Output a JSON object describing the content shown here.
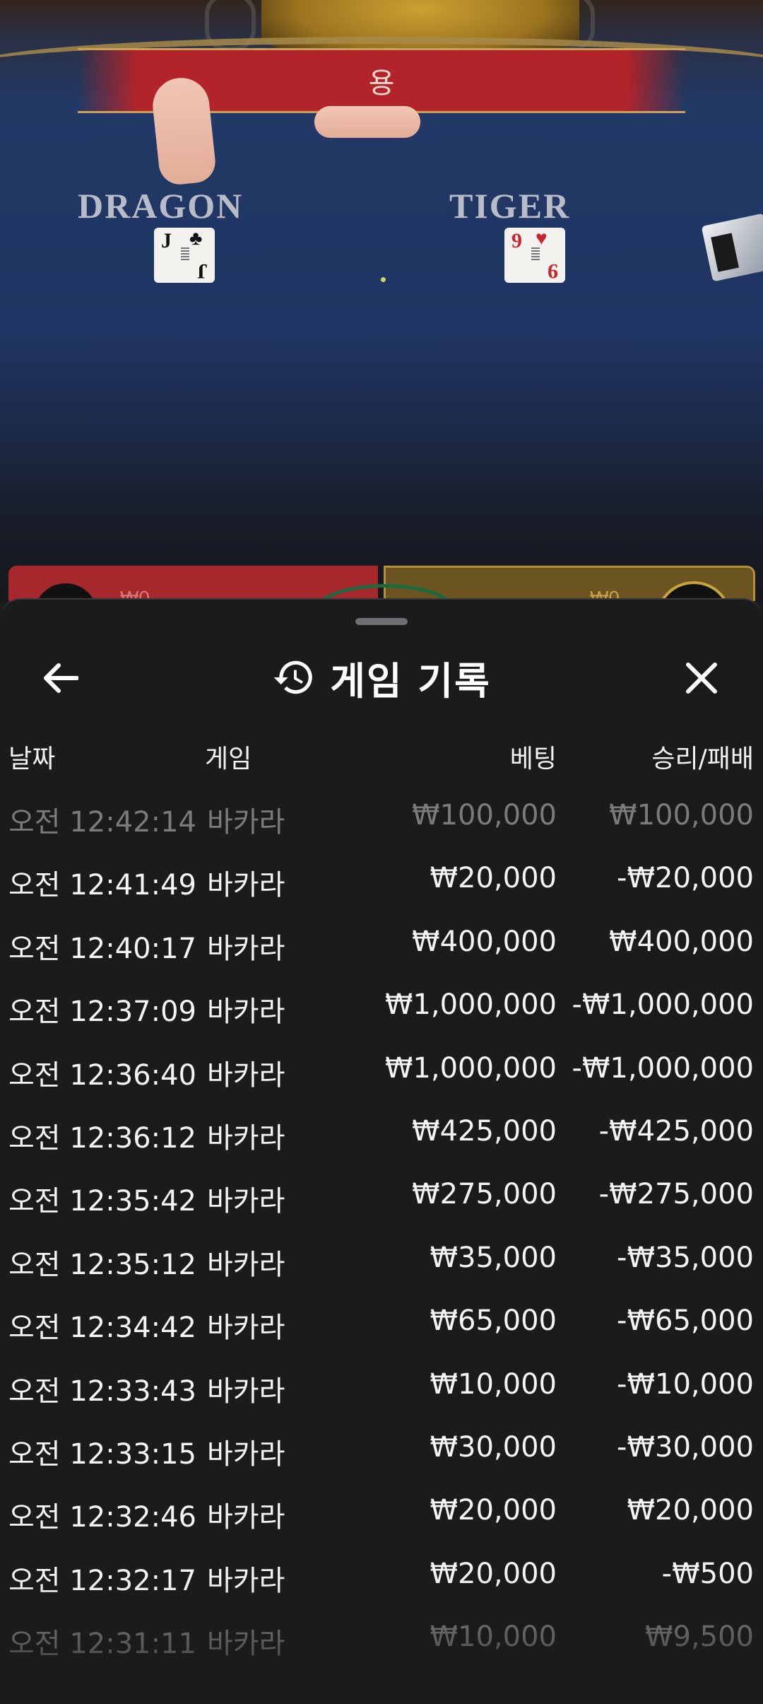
{
  "video": {
    "result_banner": "용",
    "dragon_label": "DRAGON",
    "tiger_label": "TIGER",
    "dragon_card": {
      "rank": "J",
      "suit": "♣",
      "color": "#111111"
    },
    "tiger_card": {
      "rank": "9",
      "rank_bottom": "6",
      "suit": "♥",
      "color": "#c8262c"
    },
    "bet_left": "₩0",
    "bet_right": "₩0"
  },
  "sheet": {
    "title": "게임 기록",
    "back_icon": "arrow-left-icon",
    "history_icon": "history-clock-icon",
    "close_icon": "close-x-icon",
    "columns": {
      "date": "날짜",
      "game": "게임",
      "bet": "베팅",
      "winloss": "승리/패배"
    },
    "rows": [
      {
        "date": "오전 12:42:14",
        "game": "바카라",
        "bet": "₩100,000",
        "winloss": "₩100,000"
      },
      {
        "date": "오전 12:41:49",
        "game": "바카라",
        "bet": "₩20,000",
        "winloss": "-₩20,000"
      },
      {
        "date": "오전 12:40:17",
        "game": "바카라",
        "bet": "₩400,000",
        "winloss": "₩400,000"
      },
      {
        "date": "오전 12:37:09",
        "game": "바카라",
        "bet": "₩1,000,000",
        "winloss": "-₩1,000,000"
      },
      {
        "date": "오전 12:36:40",
        "game": "바카라",
        "bet": "₩1,000,000",
        "winloss": "-₩1,000,000"
      },
      {
        "date": "오전 12:36:12",
        "game": "바카라",
        "bet": "₩425,000",
        "winloss": "-₩425,000"
      },
      {
        "date": "오전 12:35:42",
        "game": "바카라",
        "bet": "₩275,000",
        "winloss": "-₩275,000"
      },
      {
        "date": "오전 12:35:12",
        "game": "바카라",
        "bet": "₩35,000",
        "winloss": "-₩35,000"
      },
      {
        "date": "오전 12:34:42",
        "game": "바카라",
        "bet": "₩65,000",
        "winloss": "-₩65,000"
      },
      {
        "date": "오전 12:33:43",
        "game": "바카라",
        "bet": "₩10,000",
        "winloss": "-₩10,000"
      },
      {
        "date": "오전 12:33:15",
        "game": "바카라",
        "bet": "₩30,000",
        "winloss": "-₩30,000"
      },
      {
        "date": "오전 12:32:46",
        "game": "바카라",
        "bet": "₩20,000",
        "winloss": "₩20,000"
      },
      {
        "date": "오전 12:32:17",
        "game": "바카라",
        "bet": "₩20,000",
        "winloss": "-₩500"
      },
      {
        "date": "오전 12:31:11",
        "game": "바카라",
        "bet": "₩10,000",
        "winloss": "₩9,500"
      }
    ]
  }
}
